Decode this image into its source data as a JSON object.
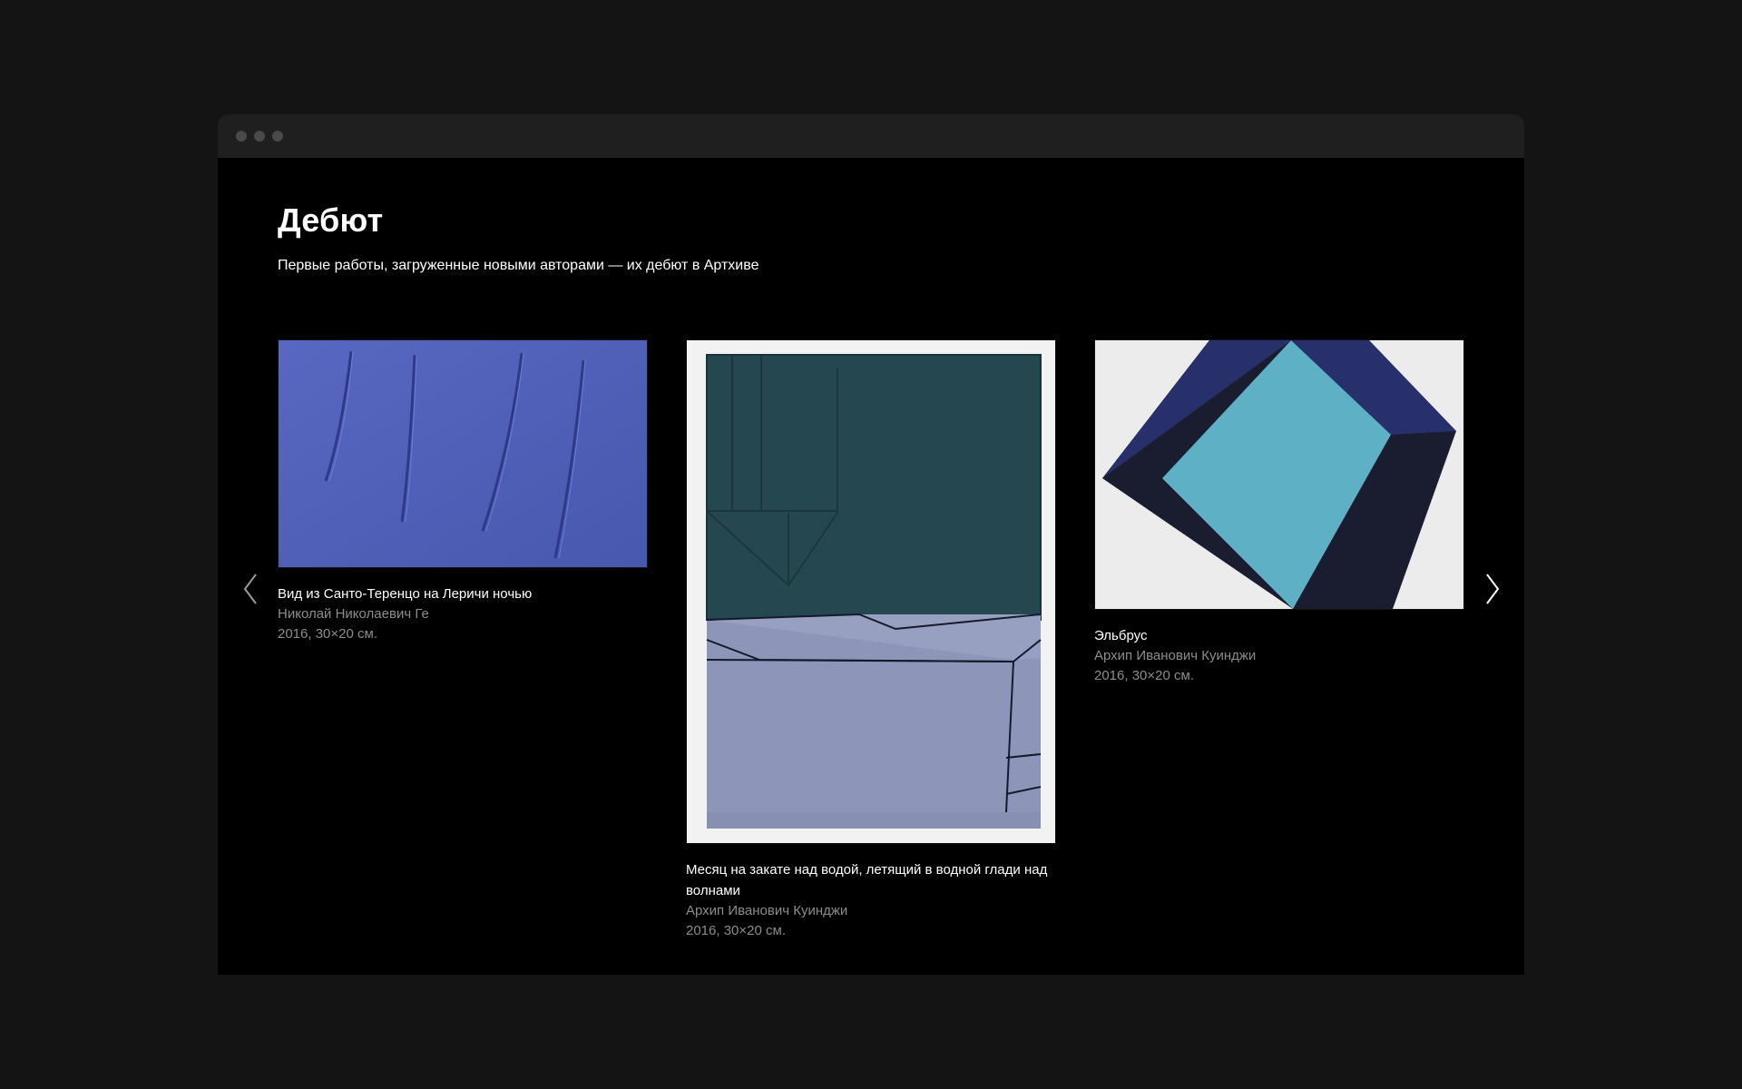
{
  "page": {
    "title": "Дебют",
    "subtitle": "Первые работы, загруженные новыми авторами — их дебют в Артхиве"
  },
  "navigation": {
    "prev_icon": "chevron-left-icon",
    "next_icon": "chevron-right-icon"
  },
  "artworks": [
    {
      "title": "Вид из Санто-Теренцо на Леричи ночью",
      "author": "Николай Николаевич Ге",
      "meta": "2016, 30×20 см.",
      "image_colors": [
        "#5060b8",
        "#2d3782"
      ]
    },
    {
      "title": "Месяц на закате над водой, летящий в водной глади над волнами",
      "author": "Архип Иванович Куинджи",
      "meta": "2016, 30×20 см.",
      "image_colors": [
        "#24464f",
        "#8a93b6",
        "#f3f3f3"
      ]
    },
    {
      "title": "Эльбрус",
      "author": "Архип Иванович Куинджи",
      "meta": "2016, 30×20 см.",
      "image_colors": [
        "#eeeeee",
        "#252d62",
        "#191b2c",
        "#5aaec2"
      ]
    }
  ],
  "colors": {
    "background": "#141414",
    "panel": "#000000",
    "text_primary": "#ffffff",
    "text_secondary": "#8c8c8c"
  }
}
